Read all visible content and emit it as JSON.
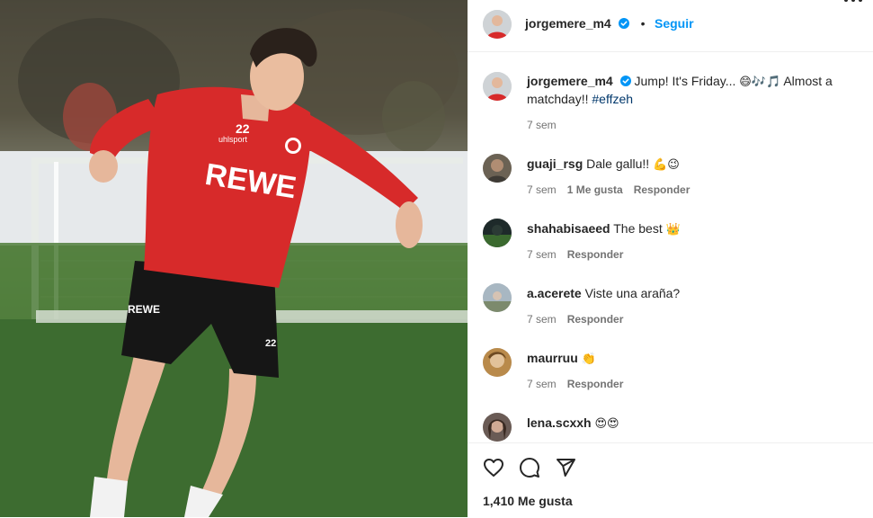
{
  "post": {
    "author": "jorgemere_m4",
    "follow_label": "Seguir",
    "separator": "•",
    "caption_text": "Jump! It's Friday... ",
    "caption_emoji": "😄🎶🎵",
    "caption_text2": " Almost a matchday!! ",
    "caption_hashtag": "#effzeh",
    "caption_time": "7 sem",
    "likes_label": "1,410 Me gusta",
    "photo_text": {
      "jersey_number": "22",
      "jersey_brand": "uhlsport",
      "sponsor": "REWE",
      "shorts_sponsor": "REWE",
      "shorts_number": "22"
    }
  },
  "comments": [
    {
      "user": "guaji_rsg",
      "text": "Dale gallu!! ",
      "emoji": "💪😉",
      "time": "7 sem",
      "likes": "1 Me gusta",
      "reply": "Responder"
    },
    {
      "user": "shahabisaeed",
      "text": "The best ",
      "emoji": "👑",
      "time": "7 sem",
      "reply": "Responder"
    },
    {
      "user": "a.acerete",
      "text": "Viste una araña?",
      "emoji": "",
      "time": "7 sem",
      "reply": "Responder"
    },
    {
      "user": "maurruu",
      "text": "",
      "emoji": "👏",
      "time": "7 sem",
      "reply": "Responder"
    },
    {
      "user": "lena.scxxh",
      "text": "",
      "emoji": "😍😍",
      "time": "",
      "reply": ""
    }
  ],
  "icons": {
    "more": "more-options-icon",
    "verified": "verified-badge-icon",
    "like": "heart-icon",
    "comment": "comment-icon",
    "share": "send-icon"
  },
  "colors": {
    "accent": "#0095f6",
    "verified": "#0095f6",
    "hashtag": "#00376b",
    "muted": "#737373",
    "jersey": "#d72a2a"
  }
}
